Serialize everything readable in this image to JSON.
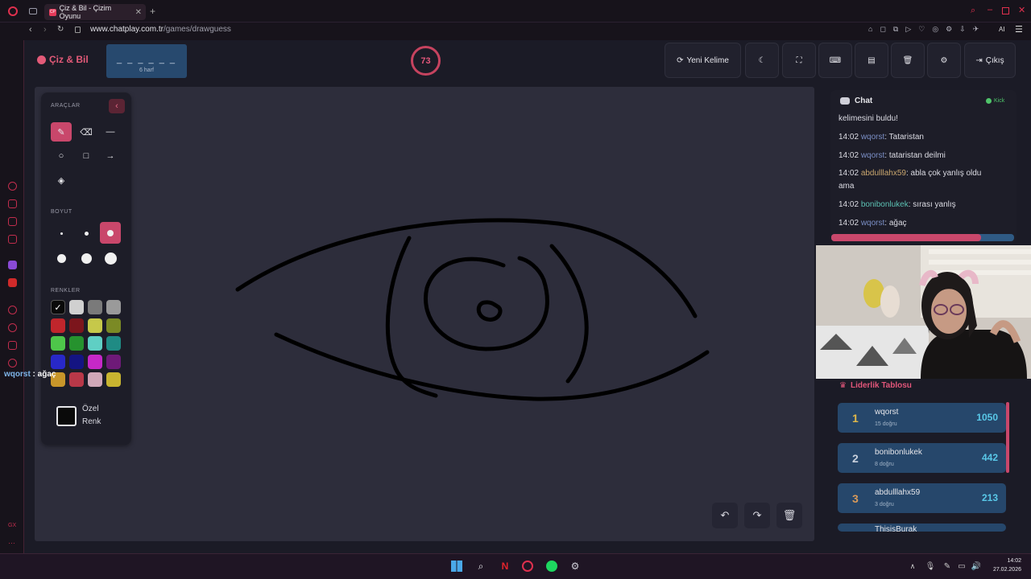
{
  "browser": {
    "tab_title": "Çiz & Bil - Çizim Oyunu",
    "tab_favicon": "CP",
    "url_domain": "www.chatplay.com.tr",
    "url_path": "/games/drawguess"
  },
  "header": {
    "logo": "Çiz & Bil",
    "word_dashes": "_ _ _ _ _ _",
    "word_length": "6 harf",
    "timer": "73",
    "new_word_button": "Yeni Kelime",
    "exit_button": "Çıkış"
  },
  "tools": {
    "tools_label": "ARAÇLAR",
    "size_label": "BOYUT",
    "colors_label": "RENKLER",
    "custom_color_line1": "Özel",
    "custom_color_line2": "Renk",
    "colors": [
      "#0a0a0a",
      "#d0d0d0",
      "#7a7a7a",
      "#9a9a9a",
      "#c0262c",
      "#7c151c",
      "#c6c84a",
      "#7b8a25",
      "#4ec64a",
      "#26922e",
      "#5fcfc4",
      "#1f8b84",
      "#2828c8",
      "#141482",
      "#c628c8",
      "#6e1a78",
      "#c8962a",
      "#b83848",
      "#d0a8b8",
      "#c8b430"
    ]
  },
  "chat": {
    "title": "Chat",
    "platform": "Kick",
    "messages": [
      {
        "time": "",
        "user": "",
        "text": "kelimesini buldu!"
      },
      {
        "time": "14:02",
        "user": "wqorst",
        "text": ": Tataristan"
      },
      {
        "time": "14:02",
        "user": "wqorst",
        "text": ": tataristan deilmi"
      },
      {
        "time": "14:02",
        "user": "abdulllahx59",
        "text": ": abla çok yanlış oldu ama"
      },
      {
        "time": "14:02",
        "user": "bonibonlukek",
        "text": ": sırası yanlış"
      },
      {
        "time": "14:02",
        "user": "wqorst",
        "text": ": ağaç"
      }
    ],
    "progress": 0.82
  },
  "leaderboard": {
    "title": "Liderlik Tablosu",
    "rows": [
      {
        "rank": "1",
        "name": "wqorst",
        "sub": "15 doğru",
        "score": "1050"
      },
      {
        "rank": "2",
        "name": "bonibonlukek",
        "sub": "8 doğru",
        "score": "442"
      },
      {
        "rank": "3",
        "name": "abdulllahx59",
        "sub": "3 doğru",
        "score": "213"
      },
      {
        "rank": "",
        "name": "ThisisBurak",
        "sub": "",
        "score": ""
      }
    ]
  },
  "overlay": {
    "user": "wqorst",
    "text": " : ağaç"
  },
  "taskbar": {
    "time": "14:02",
    "date": "27.02.2026"
  },
  "sidebar": {
    "gx_label": "GX"
  }
}
